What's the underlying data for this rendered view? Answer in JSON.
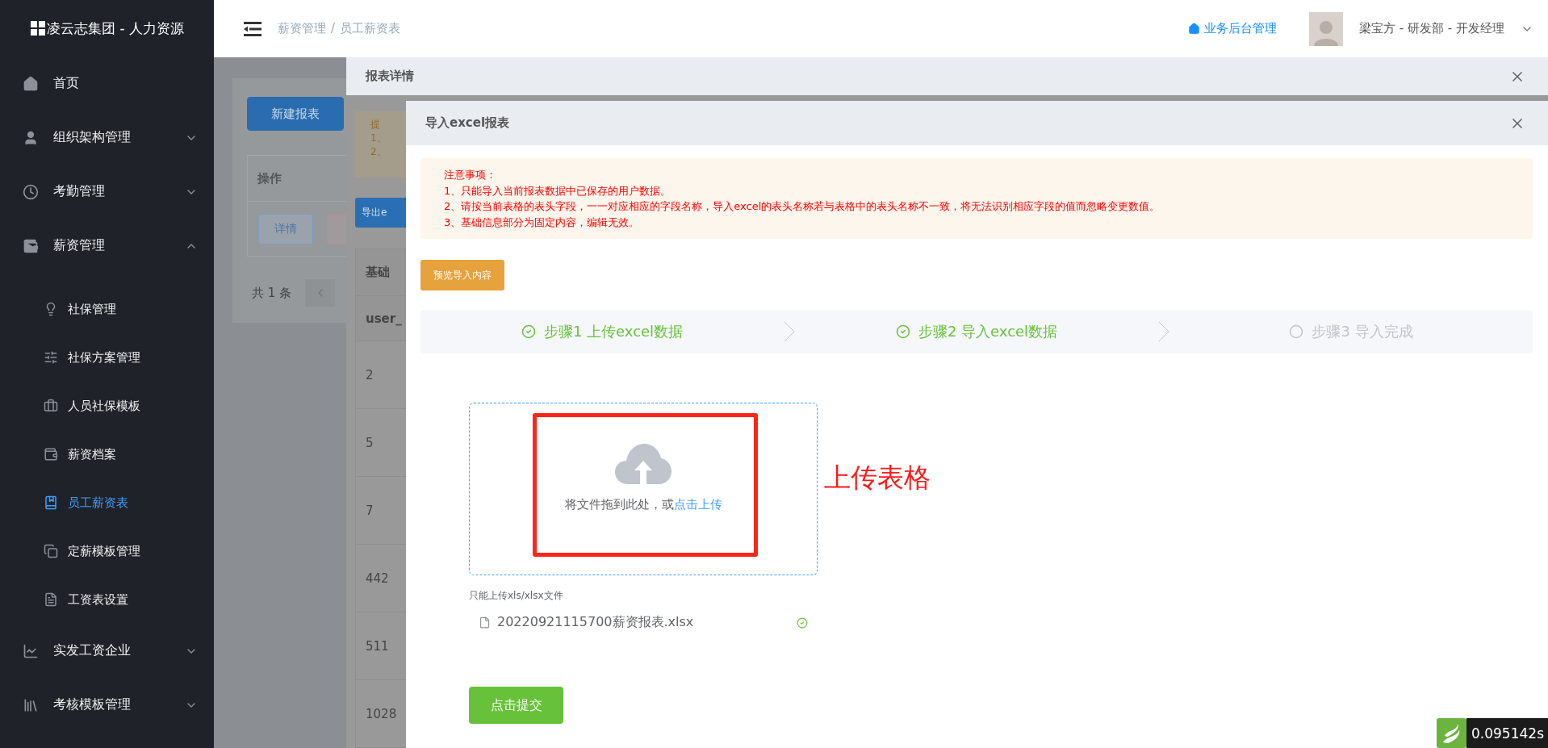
{
  "sidebar": {
    "logo": "凌云志集团 - 人力资源",
    "items": [
      {
        "label": "首页",
        "kind": "link"
      },
      {
        "label": "组织架构管理",
        "kind": "group",
        "expanded": false
      },
      {
        "label": "考勤管理",
        "kind": "group",
        "expanded": false
      },
      {
        "label": "薪资管理",
        "kind": "group",
        "expanded": true,
        "children": [
          {
            "label": "社保管理",
            "selected": false
          },
          {
            "label": "社保方案管理",
            "selected": false
          },
          {
            "label": "人员社保模板",
            "selected": false
          },
          {
            "label": "薪资档案",
            "selected": false
          },
          {
            "label": "员工薪资表",
            "selected": true
          },
          {
            "label": "定薪模板管理",
            "selected": false
          },
          {
            "label": "工资表设置",
            "selected": false
          }
        ]
      },
      {
        "label": "实发工资企业",
        "kind": "group",
        "expanded": false
      },
      {
        "label": "考核模板管理",
        "kind": "group",
        "expanded": false
      }
    ]
  },
  "header": {
    "breadcrumb": {
      "items": [
        "薪资管理",
        "员工薪资表"
      ],
      "separator": "/"
    },
    "admin_link": "业务后台管理",
    "user": "梁宝方 - 研发部 - 开发经理"
  },
  "page": {
    "new_button": "新建报表",
    "table": {
      "column": "操作",
      "action": "详情"
    },
    "pagination": {
      "total": "共 1 条"
    }
  },
  "report_drawer": {
    "title": "报表详情",
    "reminder": {
      "title": "提",
      "lines": [
        "1、",
        "2、"
      ]
    },
    "export_button": "导出e",
    "table": {
      "group_header": "基础",
      "column": "user_",
      "rows": [
        "2",
        "5",
        "7",
        "442",
        "511",
        "1028"
      ]
    }
  },
  "import_drawer": {
    "title": "导入excel报表",
    "notice": {
      "title": "注意事项：",
      "lines": [
        "1、只能导入当前报表数据中已保存的用户数据。",
        "2、请按当前表格的表头字段，一一对应相应的字段名称，导入excel的表头名称若与表格中的表头名称不一致，将无法识别相应字段的值而忽略变更数值。",
        "3、基础信息部分为固定内容，编辑无效。"
      ]
    },
    "preview_button": "预览导入内容",
    "steps": [
      {
        "label": "步骤1 上传excel数据",
        "finished": true
      },
      {
        "label": "步骤2 导入excel数据",
        "finished": true
      },
      {
        "label": "步骤3 导入完成",
        "finished": false
      }
    ],
    "upload": {
      "prompt": "将文件拖到此处，或",
      "link": "点击上传",
      "tip": "只能上传xls/xlsx文件",
      "files": [
        {
          "name": "20220921115700薪资报表.xlsx",
          "uploaded": true
        }
      ]
    },
    "annotation": "上传表格",
    "submit_button": "点击提交"
  },
  "timer_badge": "0.095142s"
}
